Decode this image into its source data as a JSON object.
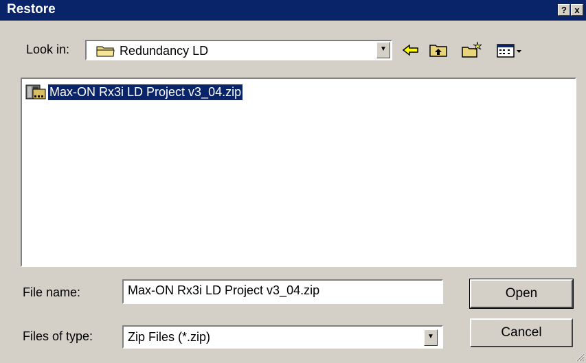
{
  "window": {
    "title": "Restore",
    "help_glyph": "?",
    "close_glyph": "x"
  },
  "lookin": {
    "label": "Look in:",
    "value": "Redundancy LD",
    "dropdown_glyph": "▼"
  },
  "toolbar": {
    "back": "back-arrow-icon",
    "up": "up-folder-icon",
    "new_folder": "new-folder-icon",
    "view_menu": "view-menu-icon"
  },
  "files": [
    {
      "name": "Max-ON Rx3i LD Project v3_04.zip",
      "icon": "zip-archive-icon",
      "selected": true
    }
  ],
  "filename": {
    "label": "File name:",
    "value": "Max-ON Rx3i LD Project v3_04.zip"
  },
  "filetype": {
    "label": "Files of type:",
    "value": "Zip Files (*.zip)",
    "dropdown_glyph": "▼"
  },
  "buttons": {
    "open": "Open",
    "cancel": "Cancel"
  },
  "colors": {
    "titlebar": "#0a246a",
    "face": "#d4d0c8",
    "selection": "#0a246a"
  }
}
